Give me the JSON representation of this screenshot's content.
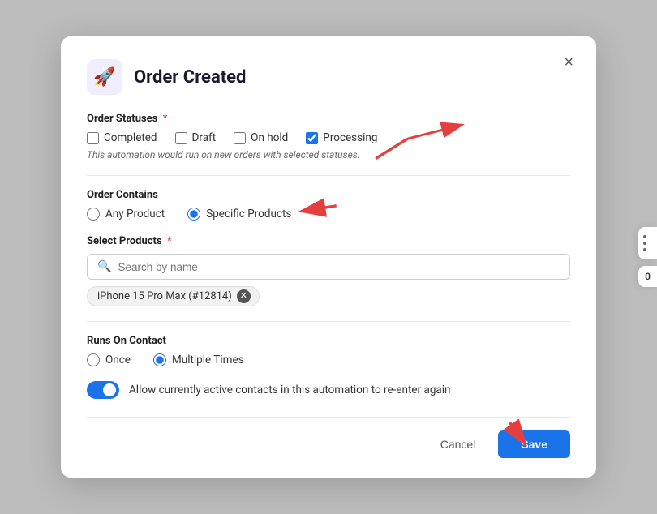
{
  "modal": {
    "title": "Order Created",
    "icon": "🚀",
    "close_label": "×"
  },
  "order_statuses": {
    "label": "Order Statuses",
    "required": true,
    "hint": "This automation would run on new orders with selected statuses.",
    "options": [
      {
        "id": "completed",
        "label": "Completed",
        "checked": false
      },
      {
        "id": "draft",
        "label": "Draft",
        "checked": false
      },
      {
        "id": "on_hold",
        "label": "On hold",
        "checked": false
      },
      {
        "id": "processing",
        "label": "Processing",
        "checked": true
      }
    ]
  },
  "order_contains": {
    "label": "Order Contains",
    "options": [
      {
        "id": "any_product",
        "label": "Any Product",
        "checked": false
      },
      {
        "id": "specific_products",
        "label": "Specific Products",
        "checked": true
      }
    ]
  },
  "select_products": {
    "label": "Select Products",
    "required": true,
    "search_placeholder": "Search by name",
    "selected_tag": "iPhone 15 Pro Max (#12814)"
  },
  "runs_on_contact": {
    "label": "Runs On Contact",
    "options": [
      {
        "id": "once",
        "label": "Once",
        "checked": false
      },
      {
        "id": "multiple_times",
        "label": "Multiple Times",
        "checked": true
      }
    ]
  },
  "toggle": {
    "label": "Allow currently active contacts in this automation to re-enter again",
    "checked": true
  },
  "footer": {
    "cancel_label": "Cancel",
    "save_label": "Save"
  }
}
